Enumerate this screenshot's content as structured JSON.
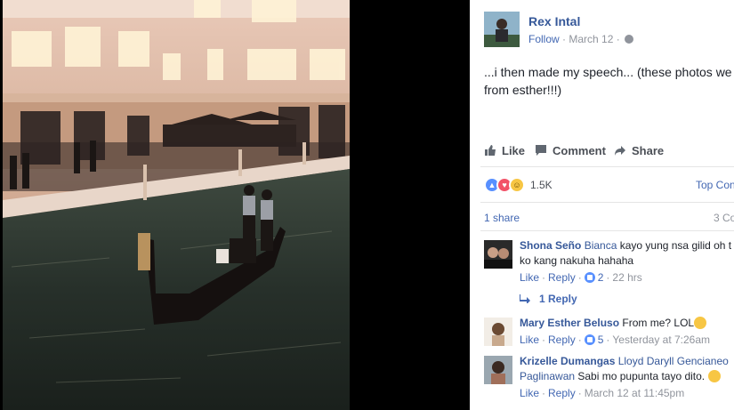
{
  "photo": {
    "alt_icon": "venice-gondola-photo"
  },
  "post": {
    "author": "Rex Intal",
    "follow": "Follow",
    "date": "March 12",
    "dot": " · ",
    "text": "...i then made my speech... (these photos we from esther!!!)"
  },
  "actions": {
    "like": "Like",
    "comment": "Comment",
    "share": "Share"
  },
  "reactions": {
    "count": "1.5K",
    "sort": "Top Con"
  },
  "shares": {
    "label": "1 share",
    "comments": "3 Co"
  },
  "comments": [
    {
      "author": "Shona Seño",
      "tag": "Bianca",
      "text": " kayo yung nsa gilid oh t braso ko kang nakuha hahaha",
      "like": "Like",
      "reply": "Reply",
      "likes": "2",
      "time": "22 hrs",
      "replies": "1 Reply"
    },
    {
      "author": "Mary Esther Beluso",
      "tag": "",
      "text": " From me? LOL",
      "like": "Like",
      "reply": "Reply",
      "likes": "5",
      "time": "Yesterday at 7:26am"
    },
    {
      "author": "Krizelle Dumangas",
      "tag": "Lloyd Daryll Gencianeo Paglinawan",
      "text": " Sabi mo pupunta tayo dito.",
      "like": "Like",
      "reply": "Reply",
      "time": "March 12 at 11:45pm"
    }
  ],
  "colors": {
    "link": "#365899",
    "accent": "#4267b2",
    "muted": "#90949c"
  }
}
